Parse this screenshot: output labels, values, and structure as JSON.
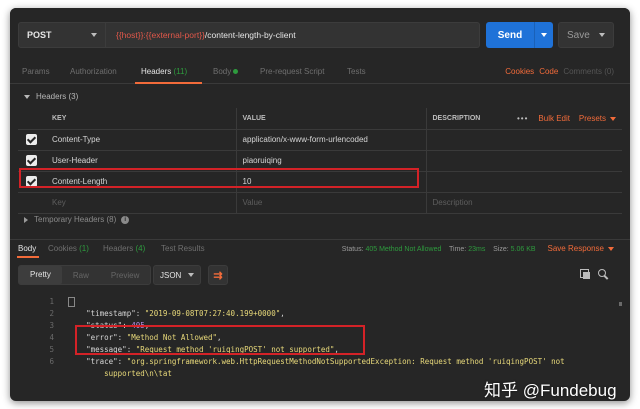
{
  "request": {
    "method": "POST",
    "url_var1": "{{host}}",
    "url_var2": "{{external-port}}",
    "url_path": "/content-length-by-client",
    "send_label": "Send",
    "save_label": "Save"
  },
  "request_tabs": [
    {
      "label": "Params",
      "count": ""
    },
    {
      "label": "Authorization",
      "count": ""
    },
    {
      "label": "Headers",
      "count": "(11)"
    },
    {
      "label": "Body",
      "count": ""
    },
    {
      "label": "Pre-request Script",
      "count": ""
    },
    {
      "label": "Tests",
      "count": ""
    }
  ],
  "request_links": {
    "cookies": "Cookies",
    "code": "Code",
    "comments": "Comments (0)"
  },
  "headers_section": {
    "title": "Headers (3)",
    "col_key": "KEY",
    "col_value": "VALUE",
    "col_description": "DESCRIPTION",
    "more": "•••",
    "bulk_edit": "Bulk Edit",
    "presets": "Presets",
    "rows": [
      {
        "key": "Content-Type",
        "value": "application/x-www-form-urlencoded",
        "description": ""
      },
      {
        "key": "User-Header",
        "value": "piaoruiqing",
        "description": ""
      },
      {
        "key": "Content-Length",
        "value": "10",
        "description": ""
      }
    ],
    "placeholder": {
      "key": "Key",
      "value": "Value",
      "description": "Description"
    },
    "temporary": "Temporary Headers (8)"
  },
  "response_tabs": [
    {
      "label": "Body",
      "count": ""
    },
    {
      "label": "Cookies",
      "count": "(1)"
    },
    {
      "label": "Headers",
      "count": "(4)"
    },
    {
      "label": "Test Results",
      "count": ""
    }
  ],
  "response_status": {
    "status_label": "Status:",
    "status_value": "405 Method Not Allowed",
    "time_label": "Time:",
    "time_value": "23ms",
    "size_label": "Size:",
    "size_value": "5.06 KB",
    "save_response": "Save Response"
  },
  "format": {
    "pretty": "Pretty",
    "raw": "Raw",
    "preview": "Preview",
    "type": "JSON"
  },
  "code_lines": [
    {
      "n": "1",
      "key": "",
      "val": "",
      "type": "brace"
    },
    {
      "n": "2",
      "key": "\"timestamp\"",
      "val": "\"2019-09-08T07:27:40.199+0000\"",
      "type": "s"
    },
    {
      "n": "3",
      "key": "\"status\"",
      "val": "405",
      "type": "n"
    },
    {
      "n": "4",
      "key": "\"error\"",
      "val": "\"Method Not Allowed\"",
      "type": "s"
    },
    {
      "n": "5",
      "key": "\"message\"",
      "val": "\"Request method 'ruiqingPOST' not supported\"",
      "type": "s"
    },
    {
      "n": "6",
      "key": "\"trace\"",
      "val": "\"org.springframework.web.HttpRequestMethodNotSupportedException: Request method 'ruiqingPOST' not",
      "type": "s"
    },
    {
      "n": "",
      "key": "",
      "val": "supported\\n\\tat",
      "type": "s"
    }
  ],
  "watermark": "知乎 @Fundebug",
  "colors": {
    "accent": "#f26b3a",
    "send": "#1f72d8",
    "highlight": "#d42227",
    "ok": "#2e9b3e",
    "background": "#262626"
  }
}
